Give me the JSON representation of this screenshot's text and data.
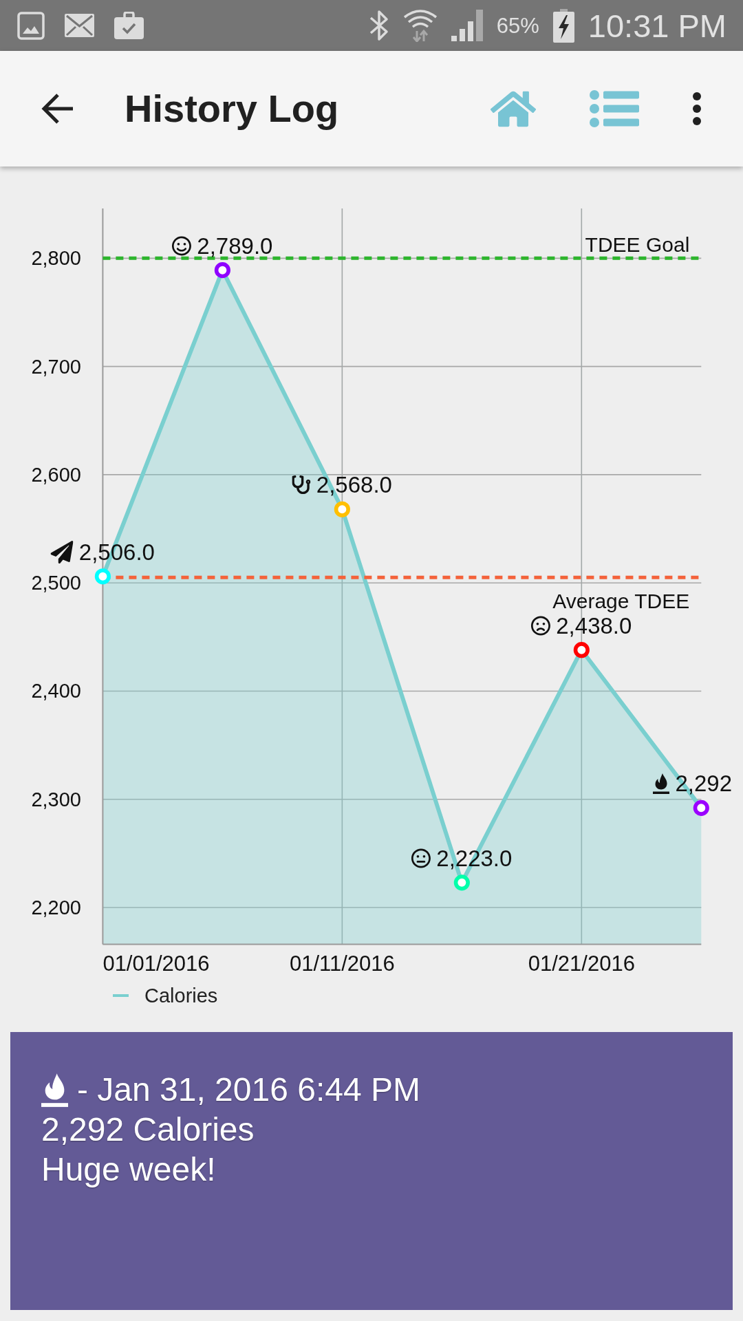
{
  "status_bar": {
    "battery_percent": "65%",
    "time": "10:31 PM"
  },
  "app_bar": {
    "title": "History Log"
  },
  "chart": {
    "chart_data": {
      "type": "area",
      "grid": true,
      "categories": [
        "01/01/2016",
        null,
        "01/11/2016",
        null,
        "01/21/2016",
        null
      ],
      "series": [
        {
          "name": "Calories",
          "color": "#7acfcf",
          "values": [
            2506,
            2789,
            2568,
            2223,
            2438,
            2292
          ]
        }
      ],
      "ylim": [
        2166,
        2846
      ],
      "yticks": [
        {
          "value": 2200,
          "label": "2,200"
        },
        {
          "value": 2300,
          "label": "2,300"
        },
        {
          "value": 2400,
          "label": "2,400"
        },
        {
          "value": 2500,
          "label": "2,500"
        },
        {
          "value": 2600,
          "label": "2,600"
        },
        {
          "value": 2700,
          "label": "2,700"
        },
        {
          "value": 2800,
          "label": "2,800"
        }
      ],
      "value_labels": [
        "2,506.0",
        "2,789.0",
        "2,568.0",
        "2,223.0",
        "2,438.0",
        "2,292"
      ],
      "ref_lines": [
        {
          "axis": "y",
          "value": 2800,
          "label": "TDEE Goal",
          "color": "#2db52d"
        },
        {
          "axis": "y",
          "value": 2505,
          "label": "Average TDEE",
          "color": "#f4623a"
        }
      ]
    },
    "markers": [
      {
        "kind": "plane",
        "color": "#00ffff"
      },
      {
        "kind": "happy",
        "color": "#8f00ff"
      },
      {
        "kind": "medical",
        "color": "#ffbf00"
      },
      {
        "kind": "neutral",
        "color": "#00ffaa"
      },
      {
        "kind": "sad",
        "color": "#ff0000"
      },
      {
        "kind": "fire",
        "color": "#9b00ff"
      }
    ]
  },
  "entry_card": {
    "kind": "fire",
    "timestamp": "- Jan 31, 2016 6:44 PM",
    "calories": "2,292 Calories",
    "note": "Huge week!"
  }
}
